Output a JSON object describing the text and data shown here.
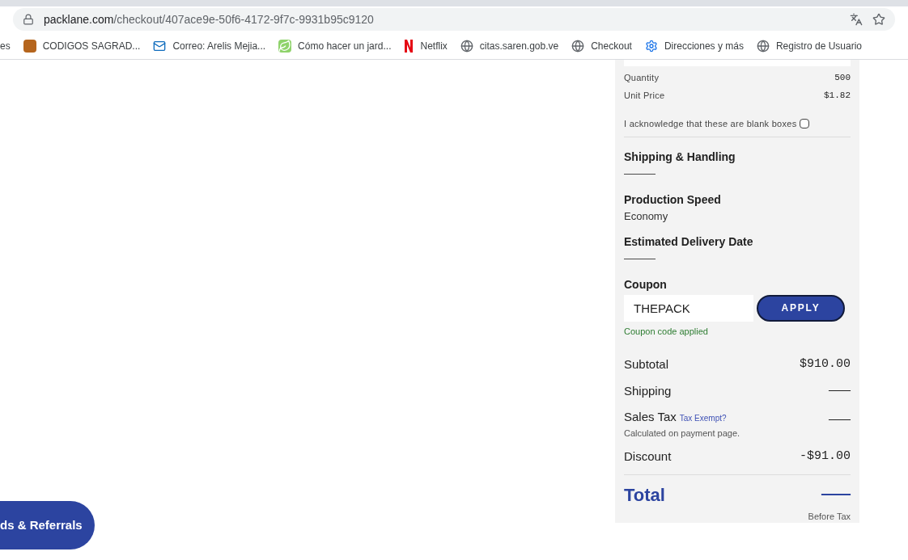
{
  "address_bar": {
    "host": "packlane.com",
    "path": "/checkout/407ace9e-50f6-4172-9f7c-9931b95c9120"
  },
  "bookmarks": [
    {
      "label": "es",
      "kind": "none"
    },
    {
      "label": "CODIGOS SAGRAD...",
      "kind": "image"
    },
    {
      "label": "Correo: Arelis Mejia...",
      "kind": "mail"
    },
    {
      "label": "Cómo hacer un jard...",
      "kind": "leaf"
    },
    {
      "label": "Netflix",
      "kind": "n"
    },
    {
      "label": "citas.saren.gob.ve",
      "kind": "globe"
    },
    {
      "label": "Checkout",
      "kind": "globe"
    },
    {
      "label": "Direcciones y más",
      "kind": "gear"
    },
    {
      "label": "Registro de Usuario",
      "kind": "globe"
    }
  ],
  "order": {
    "details": [
      {
        "label": "Quantity",
        "value": "500"
      },
      {
        "label": "Unit Price",
        "value": "$1.82"
      }
    ],
    "acknowledge": {
      "label": "I acknowledge that these are blank boxes",
      "checked": false
    },
    "sections": [
      {
        "title": "Shipping & Handling",
        "value": "———"
      },
      {
        "title": "Production Speed",
        "value": "Economy"
      },
      {
        "title": "Estimated Delivery Date",
        "value": "———"
      }
    ],
    "coupon": {
      "label": "Coupon",
      "value": "THEPACK",
      "button": "APPLY",
      "message": "Coupon code applied"
    },
    "summary": [
      {
        "label": "Subtotal",
        "value": "$910.00"
      },
      {
        "label": "Shipping",
        "value": "———"
      },
      {
        "label": "Sales Tax",
        "link": "Tax Exempt?",
        "note": "Calculated on payment page.",
        "value": "———"
      },
      {
        "label": "Discount",
        "value": "-$91.00"
      }
    ],
    "total": {
      "label": "Total",
      "value": "———",
      "note": "Before Tax"
    }
  },
  "rewards_button": "ds & Referrals"
}
